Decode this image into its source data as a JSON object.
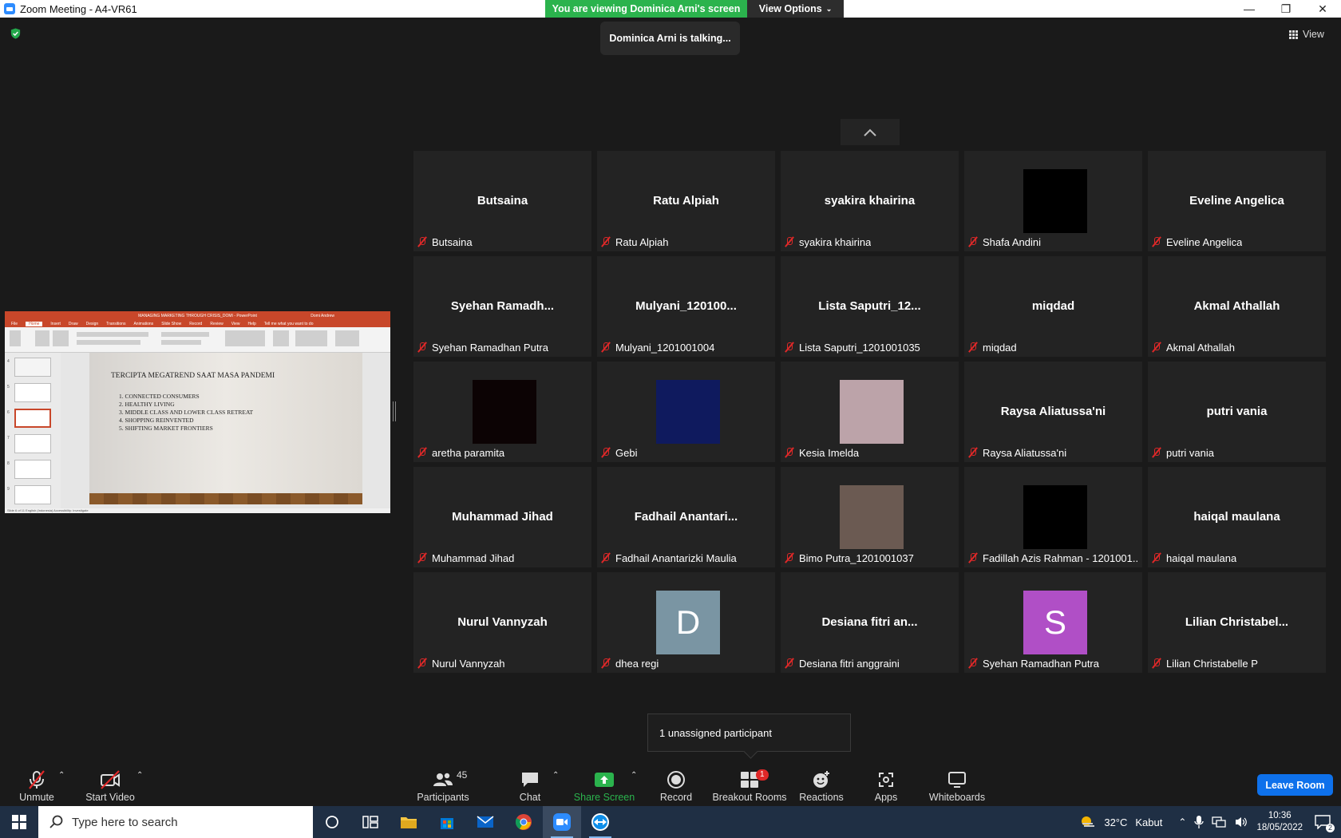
{
  "window": {
    "title": "Zoom Meeting - A4-VR61",
    "controls": [
      "—",
      "❐",
      "✕"
    ]
  },
  "banner": {
    "viewing_text": "You are viewing Dominica Arni's screen",
    "view_options_label": "View Options"
  },
  "talking_indicator": "Dominica Arni is talking...",
  "view_button_label": "View",
  "shared_screen": {
    "window_title": "MANAGING MARKETING THROUGH CRISIS_DOMI - PowerPoint",
    "user": "Domi Andrew",
    "ribbon_tabs": [
      "File",
      "Home",
      "Insert",
      "Draw",
      "Design",
      "Transitions",
      "Animations",
      "Slide Show",
      "Record",
      "Review",
      "View",
      "Help",
      "Tell me what you want to do"
    ],
    "thumbnail_numbers": [
      "4",
      "5",
      "6",
      "7",
      "8",
      "9"
    ],
    "slide_title": "TERCIPTA MEGATREND SAAT MASA PANDEMI",
    "slide_items": [
      "1.  CONNECTED CONSUMERS",
      "2.  HEALTHY LIVING",
      "3.  MIDDLE CLASS AND LOWER CLASS RETREAT",
      "4.  SHOPPING REINVENTED",
      "5.  SHIFTING MARKET FRONTIERS"
    ],
    "status_text": "Slide 6 of 11    English (Indonesia)    Accessibility: Investigate"
  },
  "participants": [
    {
      "display": "Butsaina",
      "name": "Butsaina"
    },
    {
      "display": "Ratu Alpiah",
      "name": "Ratu Alpiah"
    },
    {
      "display": "syakira khairina",
      "name": "syakira khairina"
    },
    {
      "display": "",
      "name": "Shafa Andini",
      "avatar_color": "#000000"
    },
    {
      "display": "Eveline Angelica",
      "name": "Eveline Angelica"
    },
    {
      "display": "Syehan  Ramadh...",
      "name": "Syehan Ramadhan Putra"
    },
    {
      "display": "Mulyani_120100...",
      "name": "Mulyani_1201001004"
    },
    {
      "display": "Lista  Saputri_12...",
      "name": "Lista Saputri_1201001035"
    },
    {
      "display": "miqdad",
      "name": "miqdad"
    },
    {
      "display": "Akmal Athallah",
      "name": "Akmal Athallah"
    },
    {
      "display": "",
      "name": "aretha paramita",
      "avatar_color": "#0c0304"
    },
    {
      "display": "",
      "name": "Gebi",
      "avatar_color": "#0f1a5e"
    },
    {
      "display": "",
      "name": "Kesia Imelda",
      "avatar_color": "#bca3a9"
    },
    {
      "display": "Raysa Aliatussa'ni",
      "name": "Raysa Aliatussa'ni"
    },
    {
      "display": "putri vania",
      "name": "putri vania"
    },
    {
      "display": "Muhammad Jihad",
      "name": "Muhammad Jihad"
    },
    {
      "display": "Fadhail  Anantari...",
      "name": "Fadhail Anantarizki Maulia"
    },
    {
      "display": "",
      "name": "Bimo Putra_1201001037",
      "avatar_color": "#6b5a52"
    },
    {
      "display": "",
      "name": "Fadillah Azis Rahman - 1201001...",
      "avatar_color": "#000000"
    },
    {
      "display": "haiqal maulana",
      "name": "haiqal maulana"
    },
    {
      "display": "Nurul Vannyzah",
      "name": "Nurul Vannyzah"
    },
    {
      "display": "",
      "name": "dhea regi",
      "avatar_letter": "D",
      "avatar_color": "#7a95a3"
    },
    {
      "display": "Desiana  fitri  an...",
      "name": "Desiana fitri anggraini"
    },
    {
      "display": "",
      "name": "Syehan Ramadhan Putra",
      "avatar_letter": "S",
      "avatar_color": "#b04fc6"
    },
    {
      "display": "Lilian  Christabel...",
      "name": "Lilian Christabelle P"
    }
  ],
  "unassigned_popup": "1 unassigned participant",
  "toolbar": {
    "unmute": "Unmute",
    "start_video": "Start Video",
    "participants": "Participants",
    "participants_count": "45",
    "chat": "Chat",
    "share_screen": "Share Screen",
    "record": "Record",
    "breakout_rooms": "Breakout Rooms",
    "breakout_badge": "1",
    "reactions": "Reactions",
    "apps": "Apps",
    "whiteboards": "Whiteboards",
    "leave_room": "Leave Room"
  },
  "taskbar": {
    "search_placeholder": "Type here to search",
    "weather_temp": "32°C",
    "weather_desc": "Kabut",
    "time": "10:36",
    "date": "18/05/2022",
    "notification_count": "2"
  },
  "colors": {
    "green_banner": "#2bb34d",
    "leave_button": "#0e71eb",
    "mute_red": "#e02828",
    "share_green": "#2bb34d"
  }
}
